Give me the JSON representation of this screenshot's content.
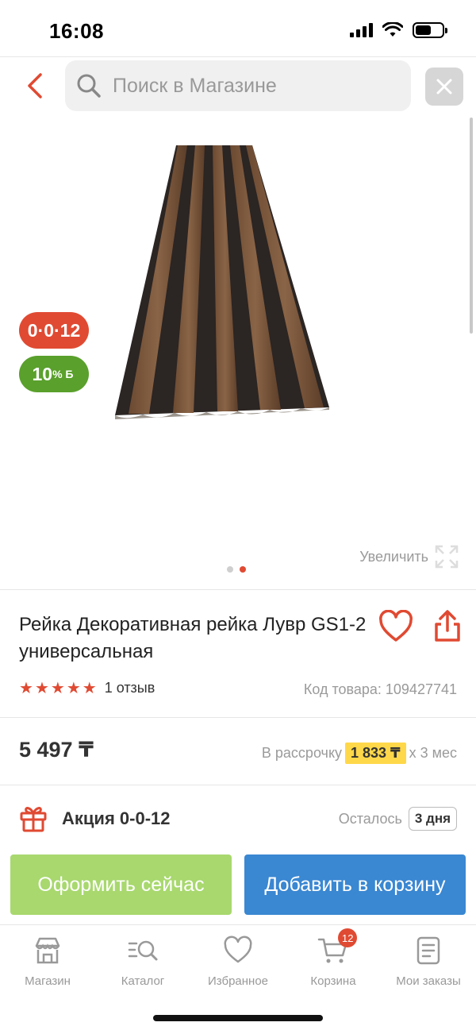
{
  "status_bar": {
    "time": "16:08"
  },
  "search": {
    "placeholder": "Поиск в Магазине"
  },
  "gallery": {
    "badge_installment": "0·0·12",
    "badge_bonus_value": "10",
    "badge_bonus_suffix": "% Б",
    "zoom_label": "Увеличить",
    "current_slide": 2,
    "total_slides": 2
  },
  "product": {
    "title": "Рейка Декоративная рейка Лувр GS1-2 универсальная",
    "rating": 5,
    "review_count": "1 отзыв",
    "sku": "Код товара: 109427741"
  },
  "price": {
    "value": "5 497 ₸",
    "installment_prefix": "В рассрочку",
    "installment_amount": "1 833 ₸",
    "installment_suffix": "х 3 мес"
  },
  "promo": {
    "label": "Акция 0-0-12",
    "remaining_prefix": "Осталось",
    "remaining_days": "3 дня"
  },
  "actions": {
    "buy_now": "Оформить сейчас",
    "add_to_cart": "Добавить в корзину"
  },
  "tabs": [
    {
      "label": "Магазин",
      "icon": "store-icon"
    },
    {
      "label": "Каталог",
      "icon": "catalog-search-icon"
    },
    {
      "label": "Избранное",
      "icon": "heart-icon"
    },
    {
      "label": "Корзина",
      "icon": "cart-icon",
      "badge": "12"
    },
    {
      "label": "Мои заказы",
      "icon": "orders-icon"
    }
  ],
  "colors": {
    "accent_red": "#e04a32",
    "bonus_green": "#5aa02c",
    "buy_button": "#a8d86e",
    "cart_button": "#3a87d2",
    "installment_highlight": "#ffd84a"
  }
}
